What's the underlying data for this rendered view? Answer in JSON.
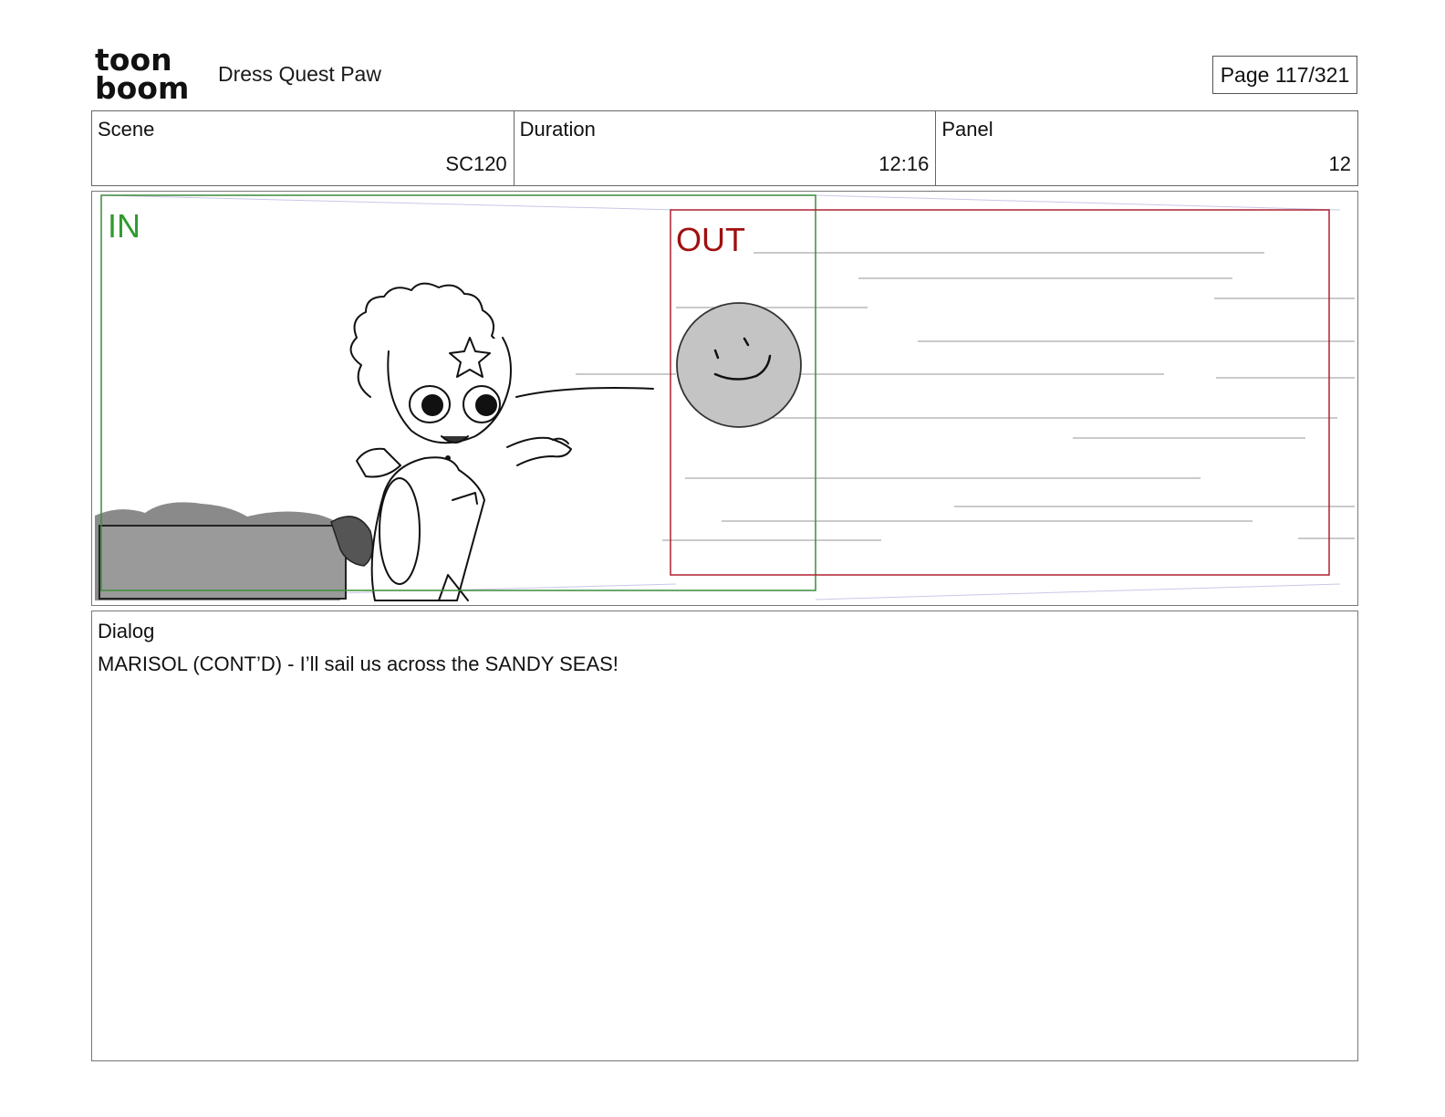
{
  "header": {
    "logo_line1": "toon",
    "logo_line2": "boom",
    "project_title": "Dress Quest Paw",
    "page_label": "Page 117/321"
  },
  "info": {
    "scene_label": "Scene",
    "scene_value": "SC120",
    "duration_label": "Duration",
    "duration_value": "12:16",
    "panel_label": "Panel",
    "panel_value": "12"
  },
  "panel": {
    "in_label": "IN",
    "out_label": "OUT",
    "in_color": "#2e8b2e",
    "out_color": "#a01010"
  },
  "dialog": {
    "label": "Dialog",
    "text": "MARISOL (CONT’D) - I’ll sail us across the SANDY SEAS!"
  }
}
